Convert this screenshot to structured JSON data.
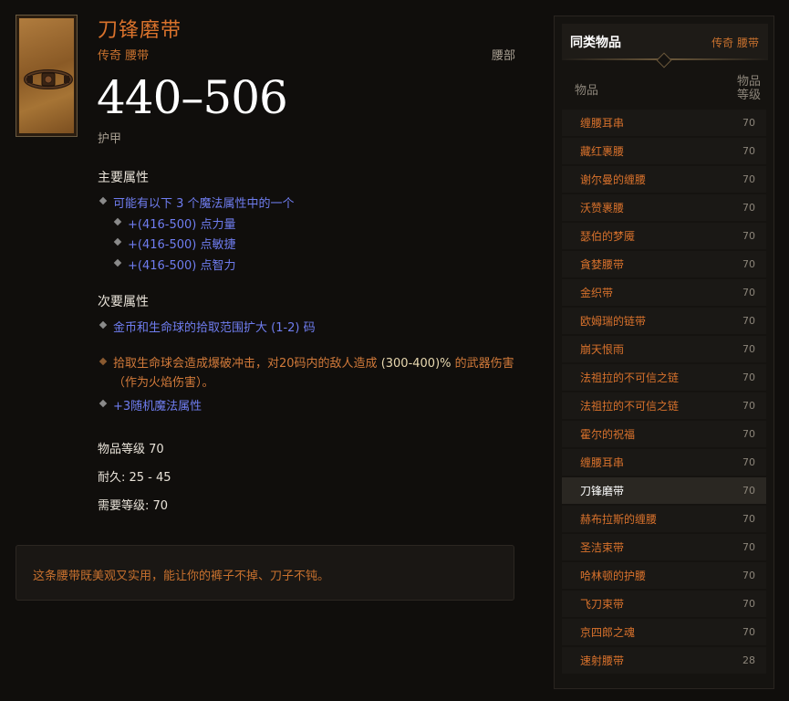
{
  "item": {
    "name": "刀锋磨带",
    "subtitle": "传奇 腰带",
    "slot": "腰部",
    "armor_value": "440–506",
    "armor_label": "护甲",
    "primary_title": "主要属性",
    "primary_affix": "可能有以下 3 个魔法属性中的一个",
    "primary_options": [
      "+(416-500) 点力量",
      "+(416-500) 点敏捷",
      "+(416-500) 点智力"
    ],
    "secondary_title": "次要属性",
    "secondary_affix": "金币和生命球的拾取范围扩大 (1-2) 码",
    "legendary_prefix": "拾取生命球会造成爆破冲击，对20码内的敌人造成 ",
    "legendary_accent": "(300-400)%",
    "legendary_suffix": " 的武器伤害（作为火焰伤害）。",
    "random_affix": "+3随机魔法属性",
    "item_level": "物品等级 70",
    "durability": "耐久: 25 - 45",
    "required_level": "需要等级: 70",
    "flavor": "这条腰带既美观又实用，能让你的裤子不掉、刀子不钝。",
    "icon": "belt-icon"
  },
  "sidebar": {
    "title": "同类物品",
    "tags": "传奇  腰带",
    "col_name": "物品",
    "col_level_line1": "物品",
    "col_level_line2": "等级",
    "items": [
      {
        "name": "缠腰耳串",
        "level": "70"
      },
      {
        "name": "藏红裹腰",
        "level": "70"
      },
      {
        "name": "谢尔曼的缠腰",
        "level": "70"
      },
      {
        "name": "沃赞裹腰",
        "level": "70"
      },
      {
        "name": "瑟伯的梦魇",
        "level": "70"
      },
      {
        "name": "貪婪腰带",
        "level": "70"
      },
      {
        "name": "金织带",
        "level": "70"
      },
      {
        "name": "欧姆瑞的链带",
        "level": "70"
      },
      {
        "name": "崩天恨雨",
        "level": "70"
      },
      {
        "name": "法祖拉的不可信之链",
        "level": "70"
      },
      {
        "name": "法祖拉的不可信之链",
        "level": "70"
      },
      {
        "name": "霍尔的祝福",
        "level": "70"
      },
      {
        "name": "缠腰耳串",
        "level": "70"
      },
      {
        "name": "刀锋磨带",
        "level": "70",
        "selected": true
      },
      {
        "name": "赫布拉斯的缠腰",
        "level": "70"
      },
      {
        "name": "圣洁束带",
        "level": "70"
      },
      {
        "name": "哈林顿的护腰",
        "level": "70"
      },
      {
        "name": "飞刀束带",
        "level": "70"
      },
      {
        "name": "京四郎之魂",
        "level": "70"
      },
      {
        "name": "速射腰带",
        "level": "28"
      }
    ]
  },
  "colors": {
    "legendary": "#d9722c",
    "magic": "#6f7df0",
    "accent": "#e8d8b0"
  }
}
